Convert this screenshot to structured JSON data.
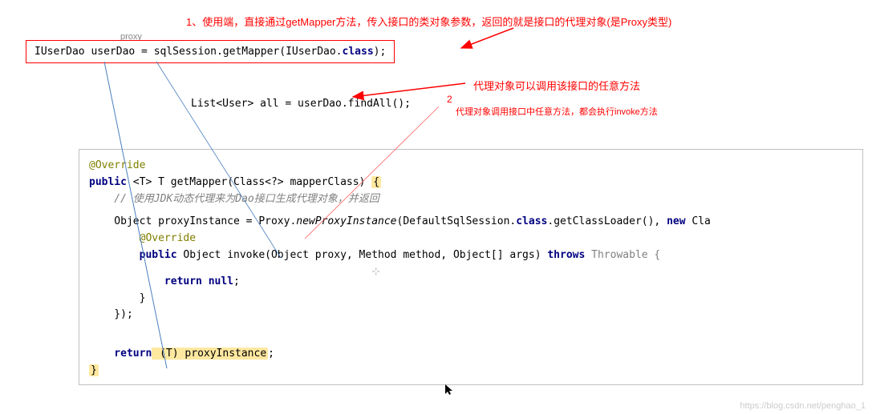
{
  "annotations": {
    "a1": "1、使用端，直接通过getMapper方法，传入接口的类对象参数，返回的就是接口的代理对象(是Proxy类型)",
    "a2": "代理对象可以调用该接口的任意方法",
    "a3": "代理对象调用接口中任意方法，都会执行invoke方法",
    "proxy_label": "proxy",
    "num2": "2"
  },
  "code1": {
    "t1": "IUserDao userDao = sqlSession.getMapper(IUserDao.",
    "t2": "class",
    "t3": ");"
  },
  "code2": {
    "t1": "List<User> all = userDao.findAll();"
  },
  "code3": {
    "override": "@Override",
    "l1a": "public",
    "l1b": " <T> T getMapper(Class<?> mapperClass) ",
    "l1c": "{",
    "l2": "    // 使用JDK动态代理来为Dao接口生成代理对象，并返回",
    "l3a": "    Object proxyInstance = Proxy.",
    "l3b": "newProxyInstance",
    "l3c": "(DefaultSqlSession.",
    "l3d": "class",
    "l3e": ".getClassLoader(), ",
    "l3f": "new",
    "l3g": " Cla",
    "l4": "        @Override",
    "l5a": "        public",
    "l5b": " Object invoke(Object proxy, Method method, Object[] args) ",
    "l5c": "throws",
    "l5d": " Throwable {",
    "l6": "            return null",
    "l6b": ";",
    "l7": "        }",
    "l8": "    });",
    "l9a": "    return",
    "l9b": " (T) proxyInstance",
    "l9c": ";",
    "l10": "}"
  },
  "watermark": "https://blog.csdn.net/penghao_1"
}
